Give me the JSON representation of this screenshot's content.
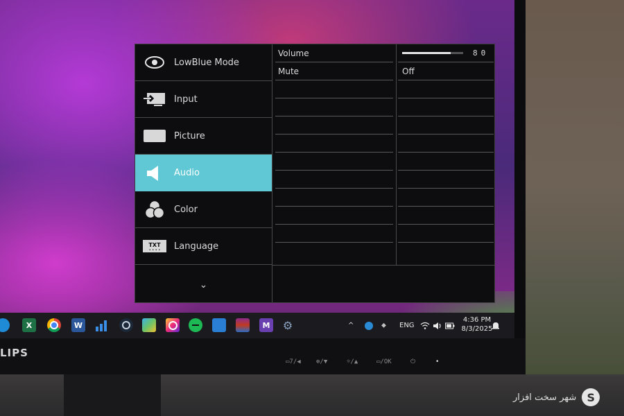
{
  "osd": {
    "menu": [
      {
        "label": "LowBlue Mode",
        "icon": "eye-icon"
      },
      {
        "label": "Input",
        "icon": "input-icon"
      },
      {
        "label": "Picture",
        "icon": "picture-icon"
      },
      {
        "label": "Audio",
        "icon": "speaker-icon",
        "active": true
      },
      {
        "label": "Color",
        "icon": "color-icon"
      },
      {
        "label": "Language",
        "icon": "language-icon",
        "icon_text": "TXT"
      }
    ],
    "more_glyph": "⌄",
    "submenu": [
      {
        "label": "Volume"
      },
      {
        "label": "Mute"
      }
    ],
    "values": {
      "volume_number": "80",
      "volume_fraction": 0.8,
      "mute": "Off"
    },
    "accent_color": "#5fc8d4"
  },
  "taskbar": {
    "apps": [
      "edge-icon",
      "excel-icon",
      "chrome-icon",
      "word-icon",
      "signal-bars-icon",
      "steam-icon",
      "photos-icon",
      "instagram-icon",
      "spotify-icon",
      "task-icon",
      "winrar-icon",
      "media-icon",
      "settings-icon"
    ],
    "tray": {
      "language": "ENG",
      "time": "4:36 PM",
      "date": "8/3/2025"
    }
  },
  "monitor": {
    "brand_visible": "LIPS",
    "controls": [
      "▭7/◀",
      "⊕/▼",
      "☼/▲",
      "▭/OK",
      "⏻",
      "•"
    ]
  },
  "watermark": {
    "text": "شهر سخت افزار",
    "logo_letter": "S"
  }
}
